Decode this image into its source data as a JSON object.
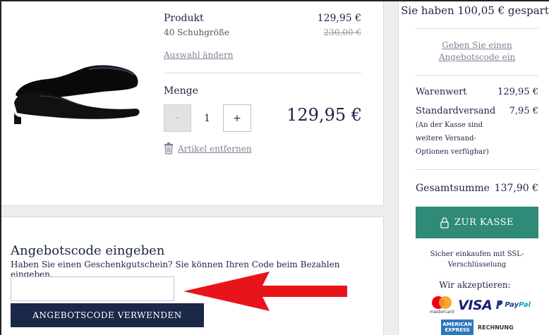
{
  "product": {
    "name": "Produkt",
    "size": "40 Schuhgröße",
    "price": "129,95 €",
    "old_price": "230,00 €",
    "change_link": "Auswahl ändern",
    "quantity_label": "Menge",
    "minus": "-",
    "quantity": "1",
    "plus": "+",
    "line_total": "129,95 €",
    "remove_link": "Artikel entfernen"
  },
  "coupon": {
    "title": "Angebotscode eingeben",
    "subtitle": "Haben Sie einen Geschenkgutschein? Sie können Ihren Code beim Bezahlen eingeben.",
    "input_value": "",
    "button": "ANGEBOTSCODE VERWENDEN"
  },
  "summary": {
    "saved": "Sie haben 100,05 € gespart",
    "promo_link": "Geben Sie einen Angebotscode ein",
    "subtotal_label": "Warenwert",
    "subtotal_value": "129,95 €",
    "shipping_label": "Standardversand",
    "shipping_value": "7,95 €",
    "shipping_note": "(An der Kasse sind weitere Versand-Optionen verfügbar)",
    "total_label": "Gesamtsumme",
    "total_value": "137,90 €",
    "checkout": "ZUR KASSE",
    "secure": "Sicher einkaufen mit SSL-Verschlüsselung",
    "accept": "Wir akzeptieren:"
  },
  "payment_logos": {
    "mastercard": "mastercard",
    "visa": "VISA",
    "paypal_pay": "Pay",
    "paypal_pal": "Pal",
    "amex_line1": "AMERICAN",
    "amex_line2": "EXPRESS",
    "rechnung": "RECHNUNG"
  },
  "colors": {
    "navy": "#1c2847",
    "checkout_green": "#2f8a78",
    "arrow_red": "#e8141c",
    "link_grey": "#7d8396"
  },
  "icons": [
    "shoe-image",
    "trash-icon",
    "lock-icon",
    "red-arrow-annotation"
  ]
}
